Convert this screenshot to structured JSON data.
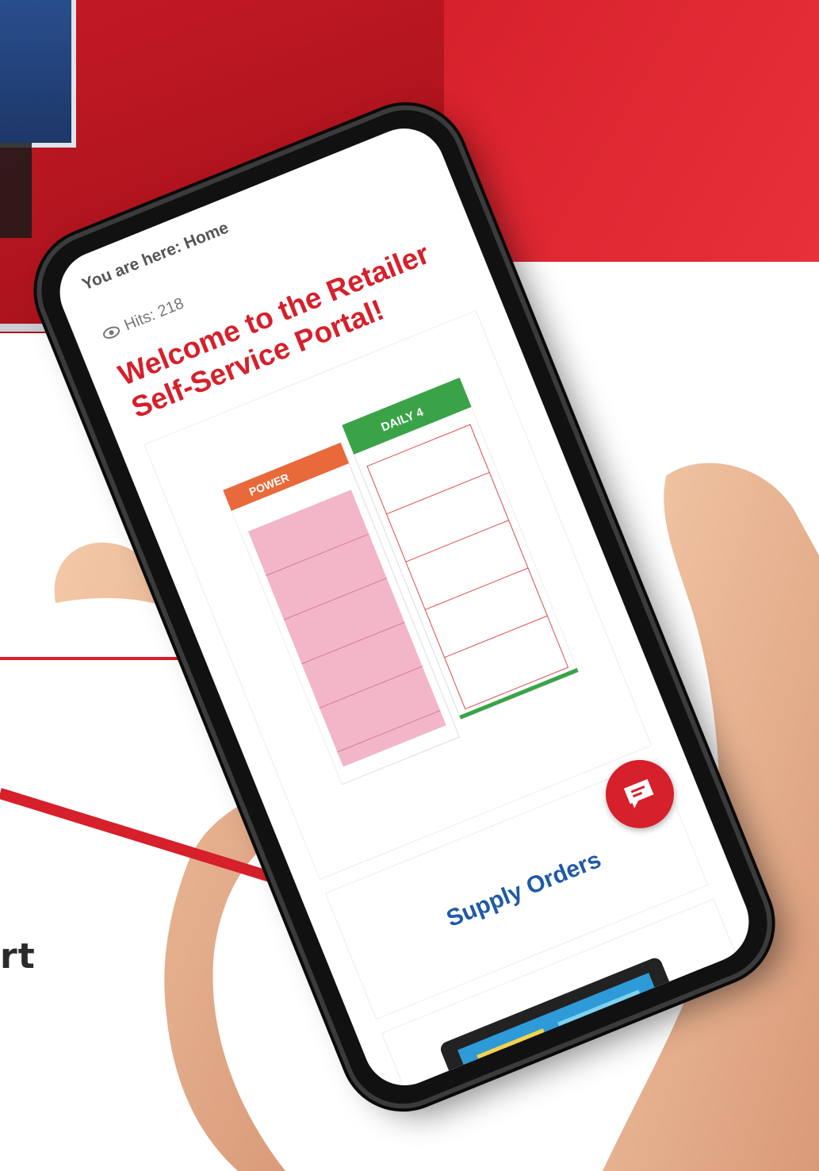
{
  "page": {
    "breadcrumb": "You are here: Home",
    "hits_label": "Hits: 218",
    "welcome_title": "Welcome to the Retailer Self-Service Portal!",
    "supply_orders_link": "Supply Orders"
  },
  "background": {
    "partial_text": "rt"
  },
  "icons": {
    "hits": "eye-icon",
    "chat": "chat-icon"
  },
  "slip_labels": {
    "left_header": "POWER",
    "right_header": "DAILY 4"
  },
  "colors": {
    "brand_red": "#d6202b",
    "link_blue": "#1f5aa6",
    "powerball_pink": "#f2b6c8",
    "daily4_green": "#3aa348"
  }
}
